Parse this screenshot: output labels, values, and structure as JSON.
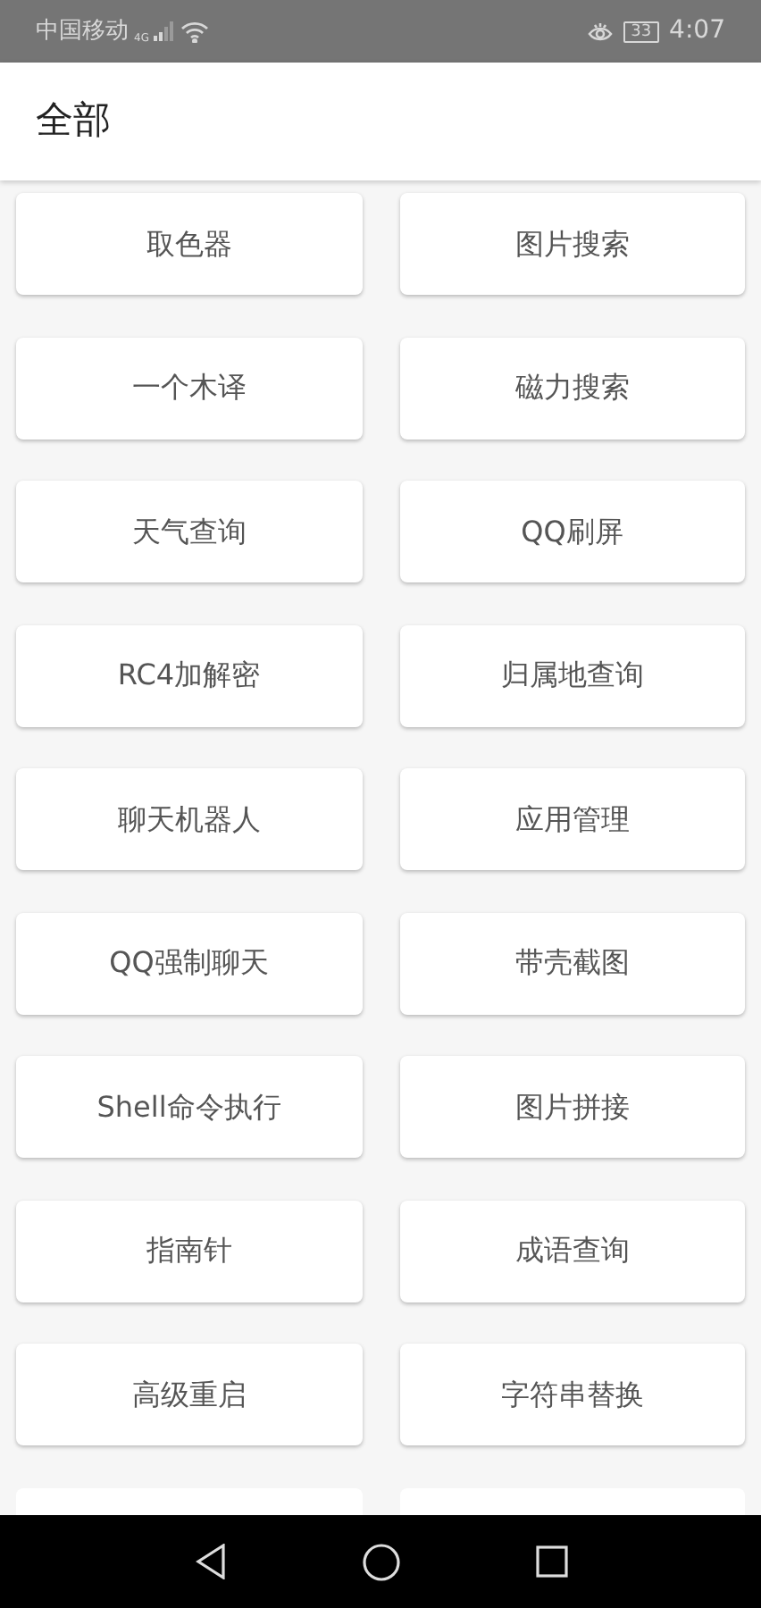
{
  "status_bar": {
    "carrier": "中国移动",
    "network": "4G",
    "battery": "33",
    "time": "4:07"
  },
  "header": {
    "title": "全部"
  },
  "tools": [
    {
      "label": "取色器"
    },
    {
      "label": "图片搜索"
    },
    {
      "label": "一个木译"
    },
    {
      "label": "磁力搜索"
    },
    {
      "label": "天气查询"
    },
    {
      "label": "QQ刷屏"
    },
    {
      "label": "RC4加解密"
    },
    {
      "label": "归属地查询"
    },
    {
      "label": "聊天机器人"
    },
    {
      "label": "应用管理"
    },
    {
      "label": "QQ强制聊天"
    },
    {
      "label": "带壳截图"
    },
    {
      "label": "Shell命令执行"
    },
    {
      "label": "图片拼接"
    },
    {
      "label": "指南针"
    },
    {
      "label": "成语查询"
    },
    {
      "label": "高级重启"
    },
    {
      "label": "字符串替换"
    }
  ]
}
